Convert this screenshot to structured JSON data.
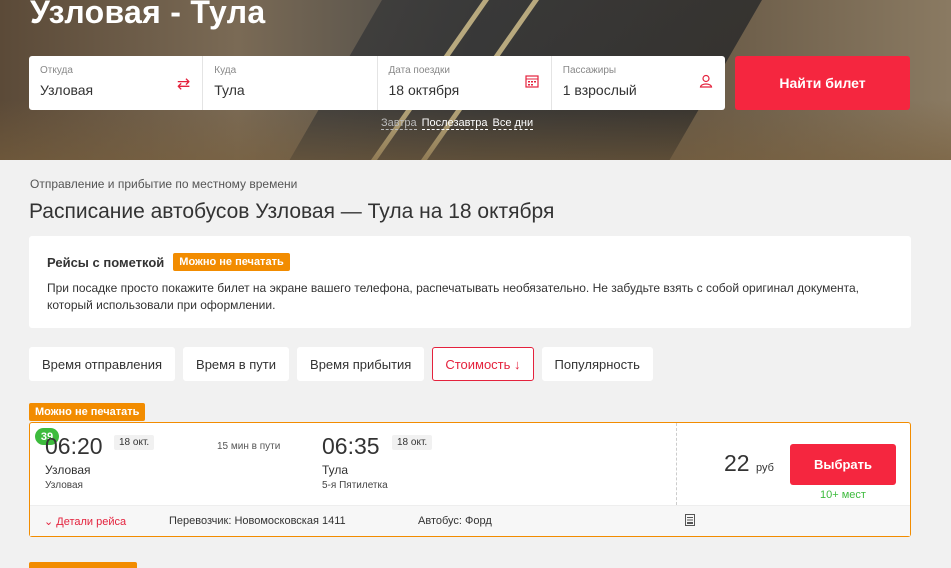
{
  "hero": {
    "title": "Узловая - Тула"
  },
  "search": {
    "from_label": "Откуда",
    "from_value": "Узловая",
    "to_label": "Куда",
    "to_value": "Тула",
    "date_label": "Дата поездки",
    "date_value": "18 октября",
    "passengers_label": "Пассажиры",
    "passengers_value": "1 взрослый",
    "find_button": "Найти билет"
  },
  "quick_dates": [
    "Завтра",
    "Послезавтра",
    "Все дни"
  ],
  "time_note": "Отправление и прибытие по местному времени",
  "page_title": "Расписание автобусов Узловая — Тула на 18 октября",
  "info": {
    "heading": "Рейсы с пометкой",
    "badge": "Можно не печатать",
    "text": "При посадке просто покажите билет на экране вашего телефона, распечатывать необязательно. Не забудьте взять с собой оригинал документа, который использовали при оформлении."
  },
  "sorts": [
    "Время отправления",
    "Время в пути",
    "Время прибытия",
    "Стоимость ↓",
    "Популярность"
  ],
  "trip": {
    "tag": "Можно не печатать",
    "count": "39",
    "dep_time": "06:20",
    "dep_date": "18 окт.",
    "dep_city": "Узловая",
    "dep_stop": "Узловая",
    "duration": "15 мин в пути",
    "arr_time": "06:35",
    "arr_date": "18 окт.",
    "arr_city": "Тула",
    "arr_stop": "5-я Пятилетка",
    "price": "22",
    "currency": "руб",
    "choose_button": "Выбрать",
    "seats": "10+ мест",
    "details": "Детали рейса",
    "carrier": "Перевозчик: Новомосковская 1411",
    "bus": "Автобус: Форд"
  }
}
